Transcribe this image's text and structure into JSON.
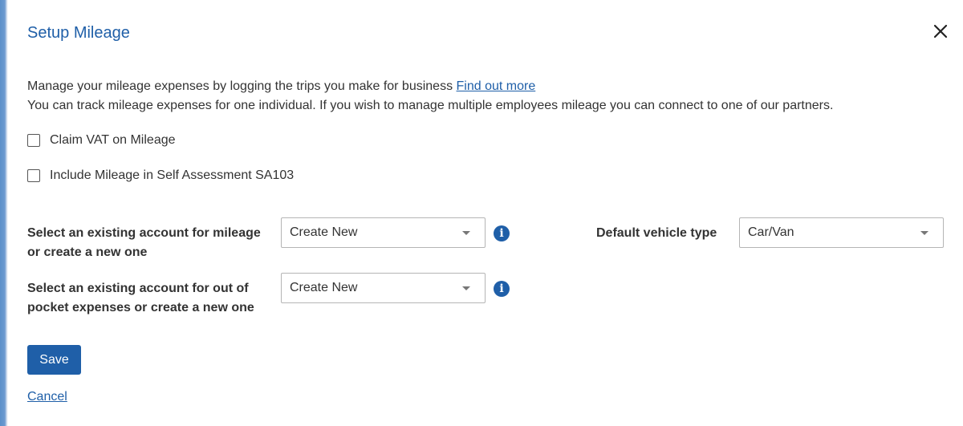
{
  "dialog": {
    "title": "Setup Mileage",
    "close_icon": "close-icon"
  },
  "intro": {
    "line1_text": "Manage your mileage expenses by logging the trips you make for business ",
    "line1_link": "Find out more",
    "line2_text": "You can track mileage expenses for one individual. If you wish to manage multiple employees mileage you can connect to one of our partners."
  },
  "options": {
    "claim_vat": {
      "label": "Claim VAT on Mileage",
      "checked": false
    },
    "include_sa103": {
      "label": "Include Mileage in Self Assessment SA103",
      "checked": false
    }
  },
  "fields": {
    "mileage_account": {
      "label": "Select an existing account for mileage or create a new one",
      "value": "Create New"
    },
    "out_of_pocket_account": {
      "label": "Select an existing account for out of pocket expenses or create a new one",
      "value": "Create New"
    },
    "vehicle_type": {
      "label": "Default vehicle type",
      "value": "Car/Van"
    },
    "info_icon_glyph": "i"
  },
  "actions": {
    "save_label": "Save",
    "cancel_label": "Cancel"
  },
  "colors": {
    "accent": "#1f5fa8",
    "text": "#333333",
    "border": "#b5b5b5"
  }
}
